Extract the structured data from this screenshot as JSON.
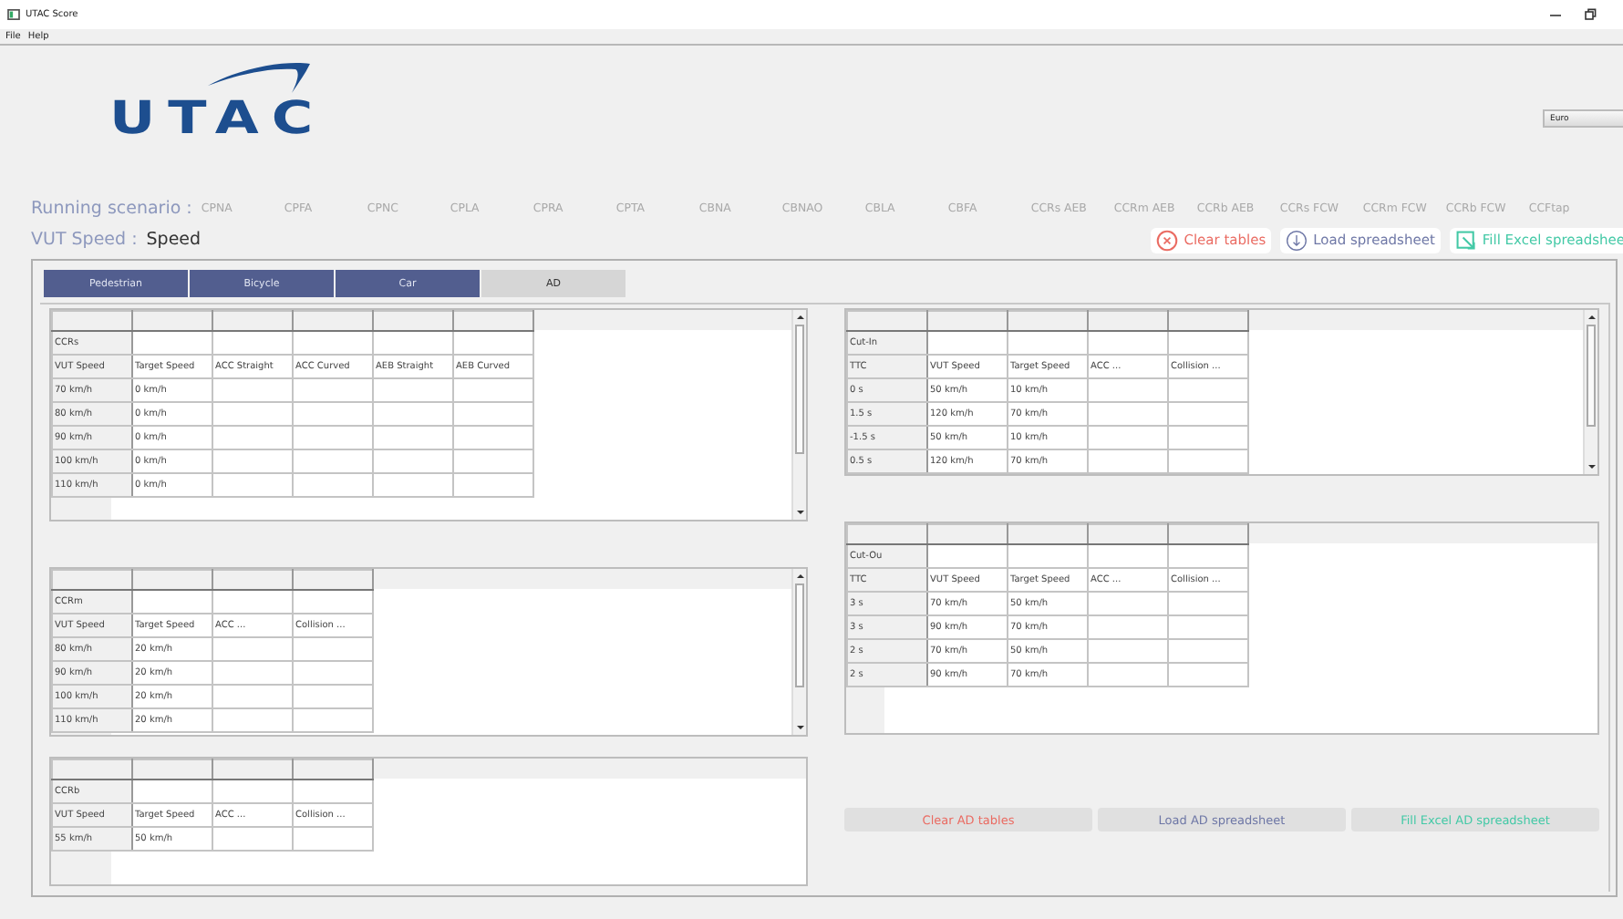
{
  "window": {
    "title": "UTAC Score"
  },
  "menu": [
    "File",
    "Help"
  ],
  "logo": {
    "text": "UTAC"
  },
  "region_select": {
    "value": "Euro"
  },
  "running_scenario": {
    "label": "Running scenario :",
    "scenarios": [
      "CPNA",
      "CPFA",
      "CPNC",
      "CPLA",
      "CPRA",
      "CPTA",
      "CBNA",
      "CBNAO",
      "CBLA",
      "CBFA",
      "CCRs AEB",
      "CCRm AEB",
      "CCRb AEB",
      "CCRs FCW",
      "CCRm FCW",
      "CCRb FCW",
      "CCFtap"
    ]
  },
  "vut_speed": {
    "label": "VUT Speed :",
    "value": "Speed"
  },
  "actions": [
    {
      "label": "Clear tables",
      "color": "#ea6b62",
      "kind": "clear"
    },
    {
      "label": "Load spreadsheet",
      "color": "#6e77a6",
      "kind": "load"
    },
    {
      "label": "Fill Excel spreadshee",
      "color": "#43c9a6",
      "kind": "fill"
    }
  ],
  "tabs": [
    {
      "label": "Pedestrian",
      "selected": false
    },
    {
      "label": "Bicycle",
      "selected": false
    },
    {
      "label": "Car",
      "selected": false
    },
    {
      "label": "AD",
      "selected": true
    }
  ],
  "left_tables": [
    {
      "name": "CCRs",
      "scrollable": true,
      "header": [
        "VUT Speed",
        "Target Speed",
        "ACC Straight",
        "ACC Curved",
        "AEB Straight",
        "AEB Curved"
      ],
      "rows": [
        [
          "70 km/h",
          "0 km/h"
        ],
        [
          "80 km/h",
          "0 km/h"
        ],
        [
          "90 km/h",
          "0 km/h"
        ],
        [
          "100 km/h",
          "0 km/h"
        ],
        [
          "110 km/h",
          "0 km/h"
        ]
      ]
    },
    {
      "name": "CCRm",
      "scrollable": true,
      "header": [
        "VUT Speed",
        "Target Speed",
        "ACC ...",
        "Collision ..."
      ],
      "rows": [
        [
          "80 km/h",
          "20 km/h"
        ],
        [
          "90 km/h",
          "20 km/h"
        ],
        [
          "100 km/h",
          "20 km/h"
        ],
        [
          "110 km/h",
          "20 km/h"
        ]
      ]
    },
    {
      "name": "CCRb",
      "scrollable": false,
      "header": [
        "VUT Speed",
        "Target Speed",
        "ACC ...",
        "Collision ..."
      ],
      "rows": [
        [
          "55 km/h",
          "50 km/h"
        ]
      ]
    }
  ],
  "right_tables": [
    {
      "name": "Cut-In",
      "scrollable": true,
      "header": [
        "TTC",
        "VUT Speed",
        "Target Speed",
        "ACC ...",
        "Collision ..."
      ],
      "rows": [
        [
          "0 s",
          "50 km/h",
          "10 km/h"
        ],
        [
          "1.5 s",
          "120 km/h",
          "70 km/h"
        ],
        [
          "-1.5 s",
          "50 km/h",
          "10 km/h"
        ],
        [
          "0.5 s",
          "120 km/h",
          "70 km/h"
        ]
      ]
    },
    {
      "name": "Cut-Ou",
      "scrollable": false,
      "header": [
        "TTC",
        "VUT Speed",
        "Target Speed",
        "ACC ...",
        "Collision ..."
      ],
      "rows": [
        [
          "3 s",
          "70 km/h",
          "50 km/h"
        ],
        [
          "3 s",
          "90 km/h",
          "70 km/h"
        ],
        [
          "2 s",
          "70 km/h",
          "50 km/h"
        ],
        [
          "2 s",
          "90 km/h",
          "70 km/h"
        ]
      ]
    }
  ],
  "ad_buttons": [
    {
      "label": "Clear AD tables",
      "color": "#ea6b62"
    },
    {
      "label": "Load AD spreadsheet",
      "color": "#6e77a6"
    },
    {
      "label": "Fill Excel AD spreadsheet",
      "color": "#43c9a6"
    }
  ]
}
